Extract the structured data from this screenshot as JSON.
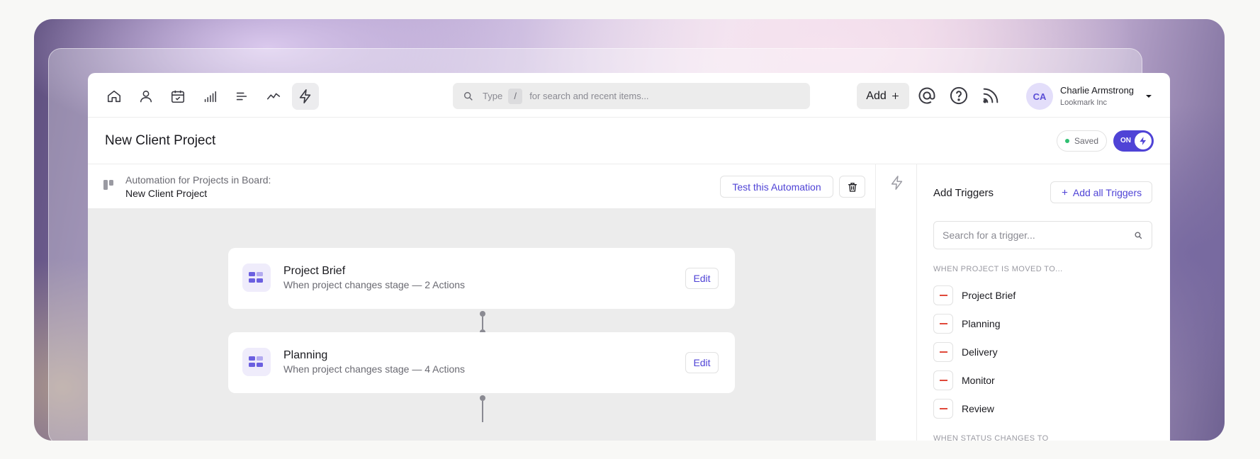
{
  "topbar": {
    "nav_icons": [
      "home-icon",
      "person-icon",
      "calendar-check-icon",
      "signal-bars-icon",
      "text-lines-icon",
      "trend-line-icon",
      "lightning-icon"
    ],
    "search": {
      "type_label": "Type",
      "shortcut": "/",
      "hint": "for search and recent items..."
    },
    "add_label": "Add",
    "tools": [
      "at-sign-icon",
      "help-icon",
      "broadcast-icon"
    ],
    "user": {
      "initials": "CA",
      "name": "Charlie Armstrong",
      "org": "Lookmark Inc"
    }
  },
  "titlebar": {
    "title": "New Client Project",
    "saved_label": "Saved",
    "toggle_label": "ON"
  },
  "automation": {
    "label": "Automation for Projects in Board:",
    "board": "New Client Project",
    "test_label": "Test this Automation"
  },
  "stages": [
    {
      "title": "Project Brief",
      "subtitle": "When project changes stage — 2 Actions",
      "edit_label": "Edit"
    },
    {
      "title": "Planning",
      "subtitle": "When project changes stage — 4 Actions",
      "edit_label": "Edit"
    }
  ],
  "panel": {
    "title": "Add Triggers",
    "add_all_label": "Add all Triggers",
    "search_placeholder": "Search for a trigger...",
    "section_moved": "WHEN PROJECT IS MOVED TO...",
    "moved_items": [
      "Project Brief",
      "Planning",
      "Delivery",
      "Monitor",
      "Review"
    ],
    "section_status": "WHEN STATUS CHANGES TO"
  },
  "colors": {
    "accent": "#4f43d6",
    "remove": "#e0493a",
    "saved_dot": "#2fbf71"
  }
}
